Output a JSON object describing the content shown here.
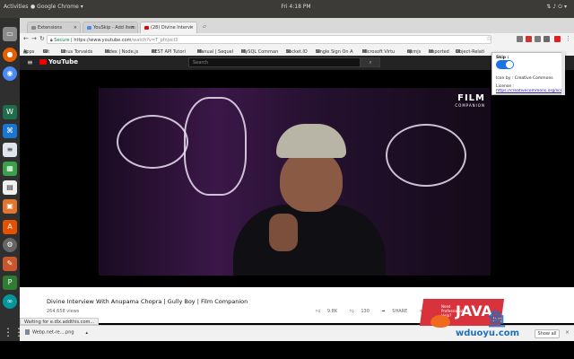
{
  "os": {
    "activities_label": "Activities",
    "app_menu_label": "Google Chrome",
    "clock": "Fri 4:18 PM",
    "tray_icons": [
      "network-icon",
      "volume-icon",
      "power-icon",
      "menu-caret-icon"
    ]
  },
  "dock": {
    "items": [
      {
        "name": "files-icon",
        "color": "#8a8a8a"
      },
      {
        "name": "firefox-icon",
        "color": "#e66000"
      },
      {
        "name": "chrome-icon",
        "color": "#4c8bf5"
      },
      {
        "name": "webstorm-icon",
        "color": "#1f6d4a"
      },
      {
        "name": "vscode-icon",
        "color": "#1976d2"
      },
      {
        "name": "text-editor-icon",
        "color": "#dfe5ea"
      },
      {
        "name": "spreadsheet-icon",
        "color": "#3aa14a"
      },
      {
        "name": "document-icon",
        "color": "#f0f0f0"
      },
      {
        "name": "presentation-icon",
        "color": "#e0772e"
      },
      {
        "name": "software-center-icon",
        "color": "#e65100"
      },
      {
        "name": "settings-icon",
        "color": "#666666"
      },
      {
        "name": "tool-icon",
        "color": "#c8572d"
      },
      {
        "name": "pycharm-icon",
        "color": "#2e7d32"
      },
      {
        "name": "arduino-icon",
        "color": "#00979c"
      }
    ],
    "app_grid_icon": "app-grid-icon"
  },
  "browser": {
    "tabs": [
      {
        "label": "Extensions",
        "active": false
      },
      {
        "label": "YouSkip - Add item",
        "active": false
      },
      {
        "label": "(28) Divine Intervi",
        "active": true
      }
    ],
    "url": {
      "secure_label": "Secure",
      "host": "https://www.youtube.com",
      "path": "/watch?v=T_pfnjxcI3"
    },
    "bookmarks": [
      "Apps",
      "Git",
      "Linus Torvalds",
      "Index | Node.js",
      "REST API Tutori",
      "Manual | Sequel",
      "MySQL Comman",
      "Socket.IO",
      "Single Sign On A",
      "Microsoft Virtu",
      "npmjs",
      "Imported",
      "Object-Relati"
    ],
    "extension_colors": [
      "#7a7a7a",
      "#cc3333",
      "#7a7a7a",
      "#6a6a6a",
      "#e02020"
    ]
  },
  "youtube": {
    "logo_label": "YouTube",
    "search_placeholder": "Search",
    "video_title": "Divine Interview With Anupama Chopra | Gully Boy | Film Companion",
    "views": "264,658 views",
    "likes": "9.8K",
    "dislikes": "130",
    "share_label": "SHARE",
    "film_logo_main": "FILM",
    "film_logo_sub": "COMPANION"
  },
  "status_text": "Waiting for e.dlx.addthis.com...",
  "download": {
    "file_name": "Webp.net-re....png",
    "show_all_label": "Show all"
  },
  "popup": {
    "skip_label": "Skip :",
    "skip_enabled": true,
    "credit": "Icon by : Creative Commons",
    "license_label": "License :",
    "license_link": "https://creativecommons.org/licenses/by/3.0/"
  },
  "ad": {
    "small_text": "Need Professional Help?",
    "big_text": "JAVA",
    "java_label": "Java"
  },
  "watermark": {
    "cn": "鱼",
    "site": "wduoyu.com"
  }
}
